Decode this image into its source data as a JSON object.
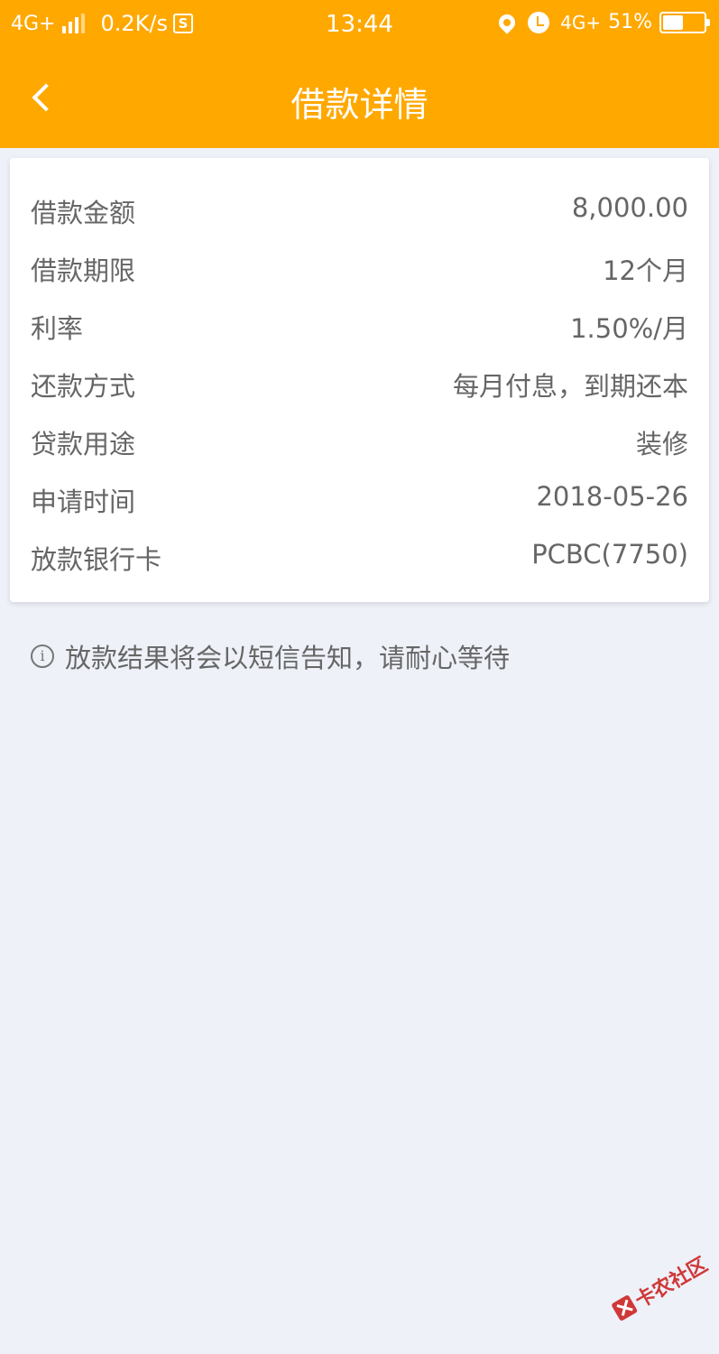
{
  "status_bar": {
    "network": "4G+",
    "speed": "0.2K/s",
    "s_icon": "S",
    "time": "13:44",
    "network_right": "4G+",
    "battery_pct": "51%",
    "battery_level": 0.51
  },
  "header": {
    "title": "借款详情",
    "back_icon": "chevron-left-icon",
    "bg_color": "#ffa800"
  },
  "details": [
    {
      "label": "借款金额",
      "value": "8,000.00"
    },
    {
      "label": "借款期限",
      "value": "12个月"
    },
    {
      "label": "利率",
      "value": "1.50%/月"
    },
    {
      "label": "还款方式",
      "value": "每月付息，到期还本"
    },
    {
      "label": "贷款用途",
      "value": "装修"
    },
    {
      "label": "申请时间",
      "value": "2018-05-26"
    },
    {
      "label": "放款银行卡",
      "value": "PCBC(7750)"
    }
  ],
  "notice": {
    "icon": "info-icon",
    "text": "放款结果将会以短信告知，请耐心等待"
  },
  "watermark": {
    "text": "卡农社区"
  }
}
